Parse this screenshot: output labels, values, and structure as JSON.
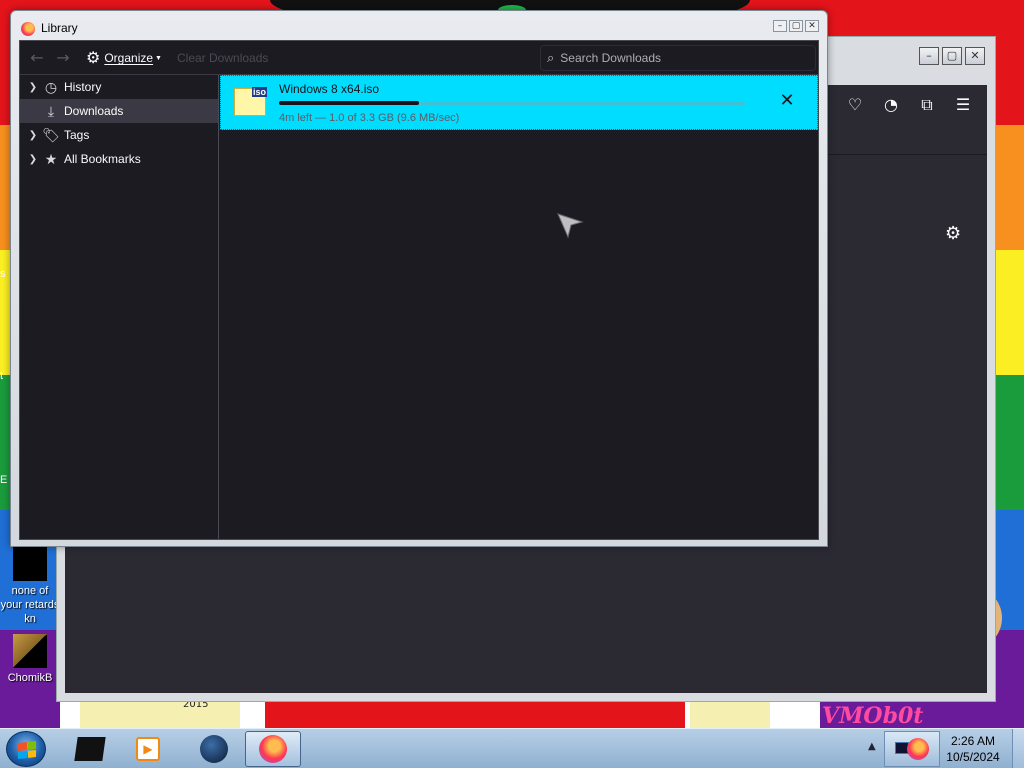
{
  "library": {
    "title": "Library",
    "toolbar": {
      "organize_label": "Organize",
      "clear_label": "Clear Downloads",
      "search_placeholder": "Search Downloads"
    },
    "sidebar": {
      "items": [
        {
          "label": "History",
          "icon": "clock-icon",
          "expandable": true,
          "selected": false
        },
        {
          "label": "Downloads",
          "icon": "download-icon",
          "expandable": false,
          "selected": true
        },
        {
          "label": "Tags",
          "icon": "tag-icon",
          "expandable": true,
          "selected": false
        },
        {
          "label": "All Bookmarks",
          "icon": "star-icon",
          "expandable": true,
          "selected": false
        }
      ]
    },
    "download": {
      "filename": "Windows 8 x64.iso",
      "file_badge": "iso",
      "status": "4m left — 1.0 of 3.3 GB (9.6 MB/sec)",
      "progress": 0.3
    }
  },
  "desktop": {
    "icons": [
      {
        "label": "none of your retards kn"
      },
      {
        "label": "ChomikB"
      }
    ],
    "year_text": "2015",
    "watermark": "VMOb0t"
  },
  "taskbar": {
    "time": "2:26 AM",
    "date": "10/5/2024"
  },
  "colors": {
    "download_highlight": "#00ddff",
    "panel_bg": "#1c1b22",
    "selected_row": "#3b3a44"
  }
}
